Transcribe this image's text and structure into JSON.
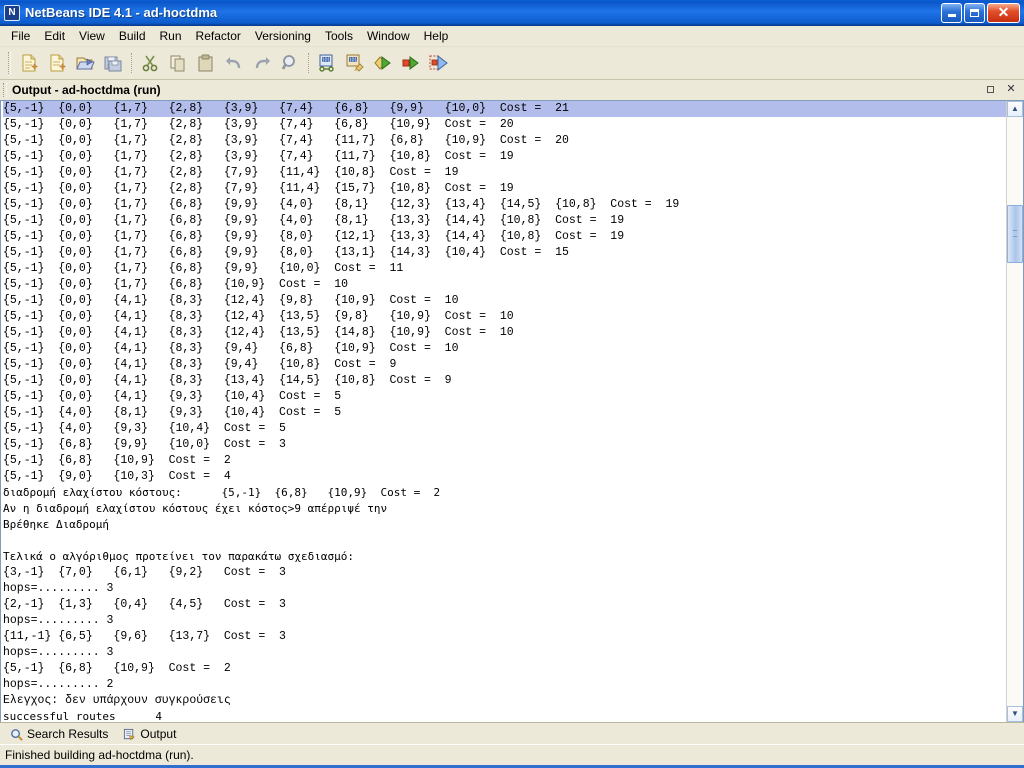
{
  "window": {
    "title": "NetBeans IDE 4.1 - ad-hoctdma",
    "app_icon": "netbeans-icon",
    "minimize_label": "",
    "restore_label": "",
    "close_label": "✕"
  },
  "menubar": {
    "items": [
      {
        "label": "File",
        "name": "menu-file"
      },
      {
        "label": "Edit",
        "name": "menu-edit"
      },
      {
        "label": "View",
        "name": "menu-view"
      },
      {
        "label": "Build",
        "name": "menu-build"
      },
      {
        "label": "Run",
        "name": "menu-run"
      },
      {
        "label": "Refactor",
        "name": "menu-refactor"
      },
      {
        "label": "Versioning",
        "name": "menu-versioning"
      },
      {
        "label": "Tools",
        "name": "menu-tools"
      },
      {
        "label": "Window",
        "name": "menu-window"
      },
      {
        "label": "Help",
        "name": "menu-help"
      }
    ]
  },
  "toolbar": {
    "buttons": [
      {
        "icon": "new-file-icon"
      },
      {
        "icon": "new-project-icon"
      },
      {
        "icon": "open-project-icon"
      },
      {
        "icon": "save-all-icon"
      },
      {
        "icon": "cut-icon"
      },
      {
        "icon": "copy-icon"
      },
      {
        "icon": "paste-icon"
      },
      {
        "icon": "undo-icon"
      },
      {
        "icon": "redo-icon"
      },
      {
        "icon": "find-icon"
      },
      {
        "icon": "build-project-icon"
      },
      {
        "icon": "clean-build-icon"
      },
      {
        "icon": "run-project-icon"
      },
      {
        "icon": "run-file-icon"
      },
      {
        "icon": "debug-project-icon"
      }
    ]
  },
  "output_panel": {
    "title": "Output - ad-hoctdma (run)",
    "maximize_label": "",
    "close_label": "✕",
    "lines": [
      "{5,-1}  {0,0}   {1,7}   {2,8}   {3,9}   {7,4}   {6,8}   {9,9}   {10,0}  Cost =  21",
      "{5,-1}  {0,0}   {1,7}   {2,8}   {3,9}   {7,4}   {6,8}   {10,9}  Cost =  20",
      "{5,-1}  {0,0}   {1,7}   {2,8}   {3,9}   {7,4}   {11,7}  {6,8}   {10,9}  Cost =  20",
      "{5,-1}  {0,0}   {1,7}   {2,8}   {3,9}   {7,4}   {11,7}  {10,8}  Cost =  19",
      "{5,-1}  {0,0}   {1,7}   {2,8}   {7,9}   {11,4}  {10,8}  Cost =  19",
      "{5,-1}  {0,0}   {1,7}   {2,8}   {7,9}   {11,4}  {15,7}  {10,8}  Cost =  19",
      "{5,-1}  {0,0}   {1,7}   {6,8}   {9,9}   {4,0}   {8,1}   {12,3}  {13,4}  {14,5}  {10,8}  Cost =  19",
      "{5,-1}  {0,0}   {1,7}   {6,8}   {9,9}   {4,0}   {8,1}   {13,3}  {14,4}  {10,8}  Cost =  19",
      "{5,-1}  {0,0}   {1,7}   {6,8}   {9,9}   {8,0}   {12,1}  {13,3}  {14,4}  {10,8}  Cost =  19",
      "{5,-1}  {0,0}   {1,7}   {6,8}   {9,9}   {8,0}   {13,1}  {14,3}  {10,4}  Cost =  15",
      "{5,-1}  {0,0}   {1,7}   {6,8}   {9,9}   {10,0}  Cost =  11",
      "{5,-1}  {0,0}   {1,7}   {6,8}   {10,9}  Cost =  10",
      "{5,-1}  {0,0}   {4,1}   {8,3}   {12,4}  {9,8}   {10,9}  Cost =  10",
      "{5,-1}  {0,0}   {4,1}   {8,3}   {12,4}  {13,5}  {9,8}   {10,9}  Cost =  10",
      "{5,-1}  {0,0}   {4,1}   {8,3}   {12,4}  {13,5}  {14,8}  {10,9}  Cost =  10",
      "{5,-1}  {0,0}   {4,1}   {8,3}   {9,4}   {6,8}   {10,9}  Cost =  10",
      "{5,-1}  {0,0}   {4,1}   {8,3}   {9,4}   {10,8}  Cost =  9",
      "{5,-1}  {0,0}   {4,1}   {8,3}   {13,4}  {14,5}  {10,8}  Cost =  9",
      "{5,-1}  {0,0}   {4,1}   {9,3}   {10,4}  Cost =  5",
      "{5,-1}  {4,0}   {8,1}   {9,3}   {10,4}  Cost =  5",
      "{5,-1}  {4,0}   {9,3}   {10,4}  Cost =  5",
      "{5,-1}  {6,8}   {9,9}   {10,0}  Cost =  3",
      "{5,-1}  {6,8}   {10,9}  Cost =  2",
      "{5,-1}  {9,0}   {10,3}  Cost =  4",
      "διαδρομή ελαχίστου κόστους:      {5,-1}  {6,8}   {10,9}  Cost =  2",
      "Αν η διαδρομή ελαχίστου κόστους έχει κόστος>9 απέρριψέ την",
      "Βρέθηκε Διαδρομή",
      "",
      "Τελικά ο αλγόριθμος προτείνει τον παρακάτω σχεδιασμό:",
      "{3,-1}  {7,0}   {6,1}   {9,2}   Cost =  3",
      "hops=......... 3",
      "{2,-1}  {1,3}   {0,4}   {4,5}   Cost =  3",
      "hops=......... 3",
      "{11,-1} {6,5}   {9,6}   {13,7}  Cost =  3",
      "hops=......... 3",
      "{5,-1}  {6,8}   {10,9}  Cost =  2",
      "hops=......... 2",
      "Ελεγχος: δεν υπάρχουν συγκρούσεις",
      "successful routes      4"
    ],
    "selected_line_index": 0,
    "greek_line_indices": [
      24,
      25,
      26,
      28,
      38
    ],
    "selection_color": "#b3bdec",
    "scrollbar": {
      "up_arrow": "▲",
      "down_arrow": "▼"
    }
  },
  "bottom_tabs": [
    {
      "label": "Search Results",
      "icon": "magnifier-icon",
      "active": false,
      "name": "tab-search-results"
    },
    {
      "label": "Output",
      "icon": "output-icon",
      "active": true,
      "name": "tab-output"
    }
  ],
  "statusbar": {
    "message": "Finished building ad-hoctdma (run)."
  },
  "colors": {
    "title_blue": "#0a56c8",
    "chrome": "#ece9d8",
    "console_bg": "#ffffff",
    "selection": "#b3bdec",
    "accent": "#2f6fd0"
  }
}
